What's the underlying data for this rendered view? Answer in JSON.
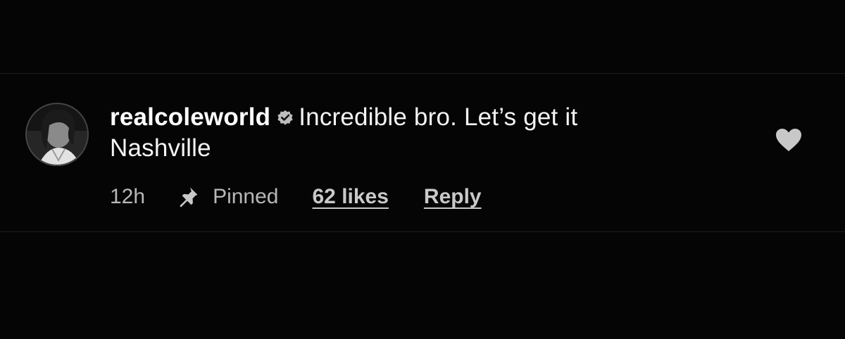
{
  "comment": {
    "username": "realcoleworld",
    "verified": true,
    "text_line1": "Incredible bro. Let’s get it",
    "text_line2": "Nashville",
    "time": "12h",
    "pinned_label": "Pinned",
    "likes_label": "62 likes",
    "reply_label": "Reply",
    "liked": false
  },
  "colors": {
    "background": "#050505",
    "text": "#f4f4f4",
    "meta_text": "#b8b8b8",
    "icon_gray": "#c8c8c8",
    "divider": "#1f1f1f"
  },
  "icons": {
    "verified": "verified-badge-icon",
    "pin": "pin-icon",
    "like": "heart-icon"
  }
}
